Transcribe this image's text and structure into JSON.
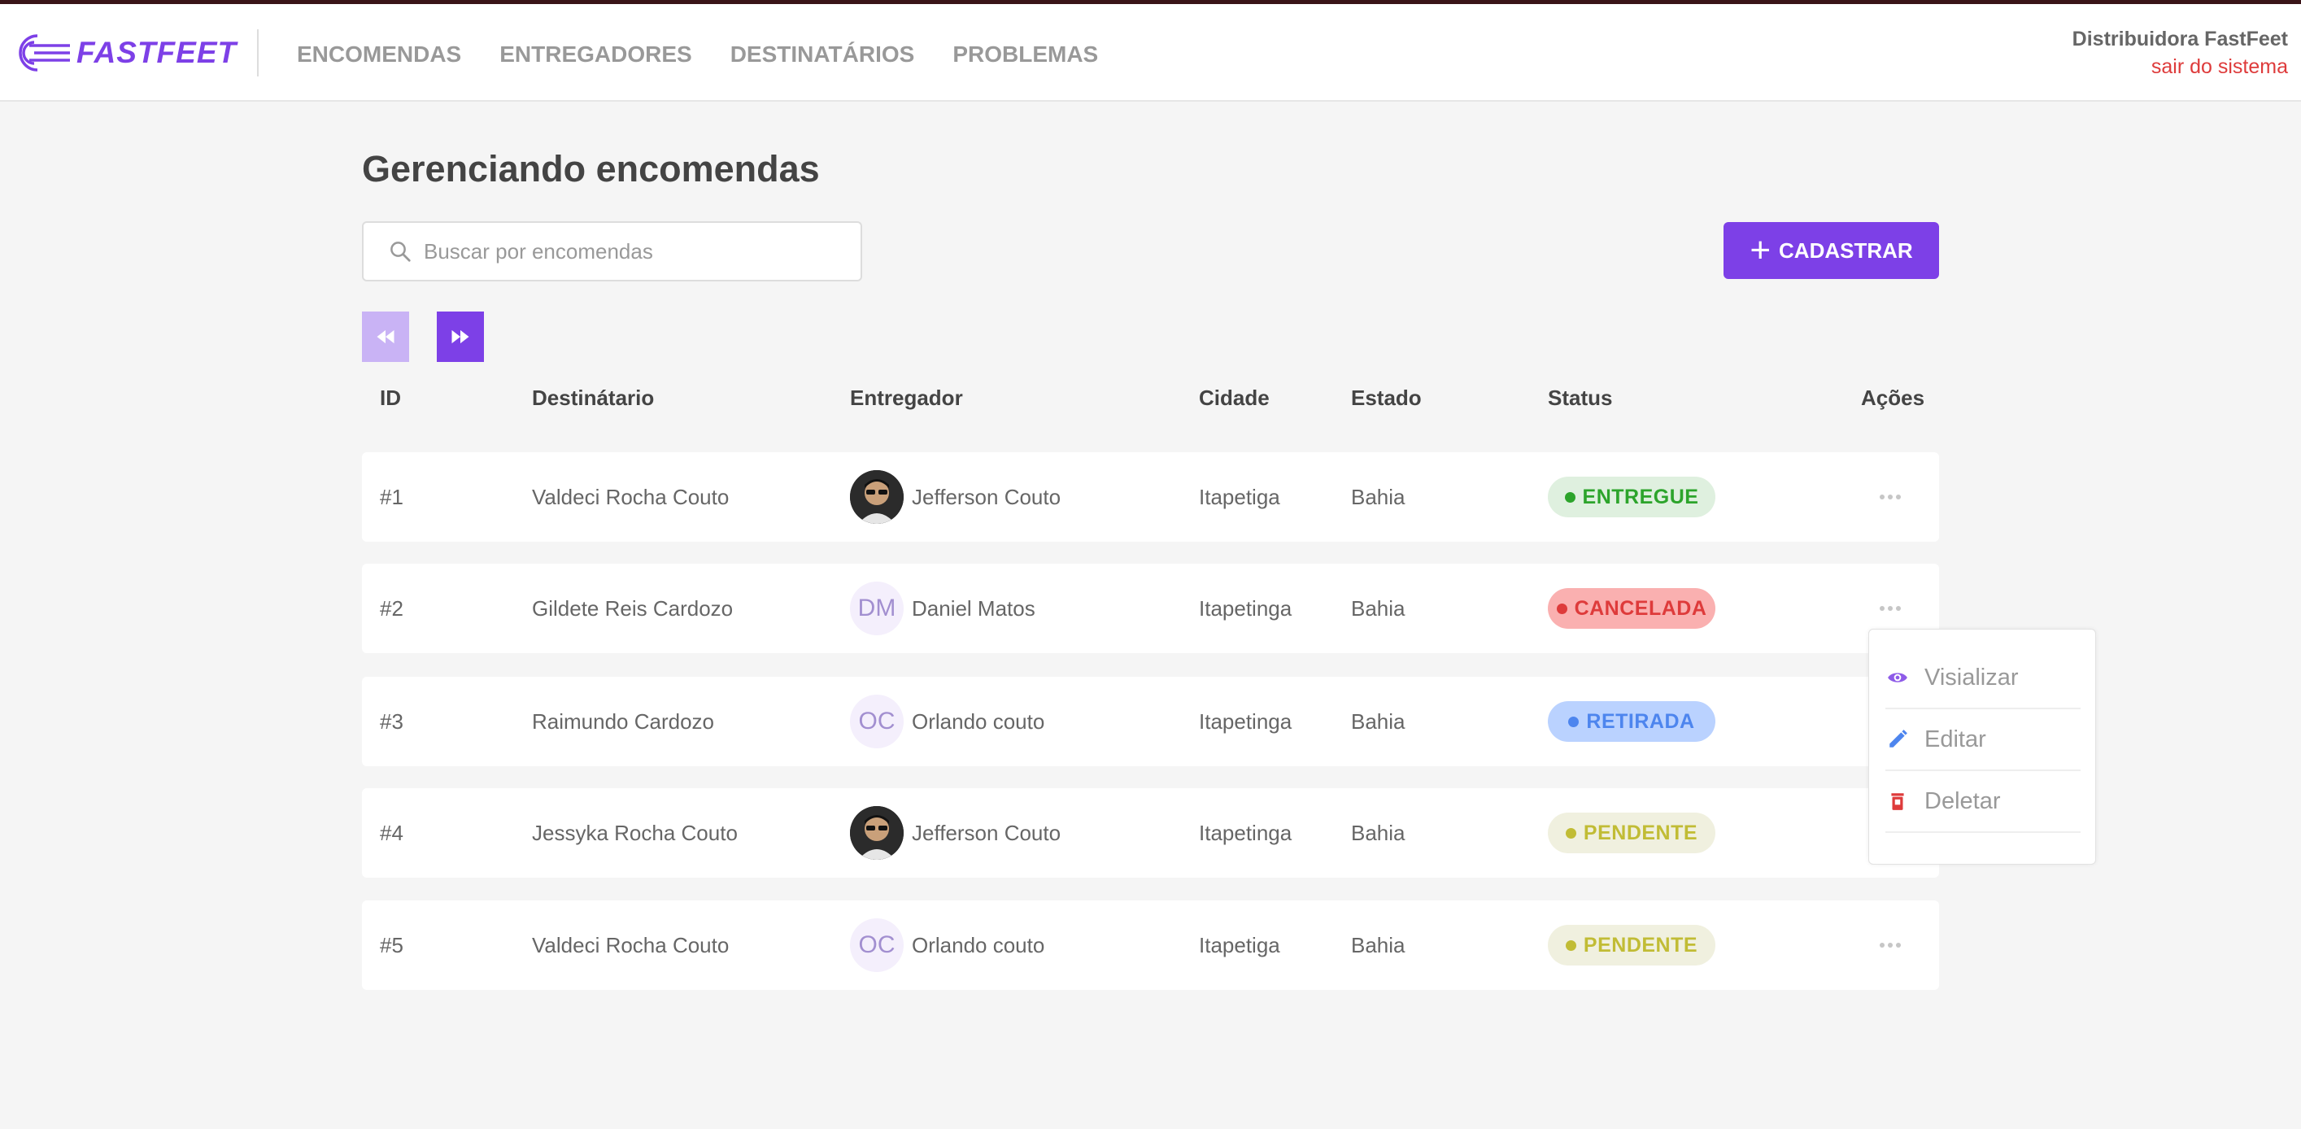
{
  "app": {
    "logo_text": "FASTFEET",
    "brand_color": "#7d40e7"
  },
  "nav": {
    "items": [
      "ENCOMENDAS",
      "ENTREGADORES",
      "DESTINATÁRIOS",
      "PROBLEMAS"
    ]
  },
  "user": {
    "name": "Distribuidora FastFeet",
    "logout": "sair do sistema"
  },
  "page": {
    "title": "Gerenciando encomendas",
    "search_placeholder": "Buscar por encomendas",
    "add_button": "CADASTRAR"
  },
  "table": {
    "headers": {
      "id": "ID",
      "recipient": "Destinátario",
      "deliveryman": "Entregador",
      "city": "Cidade",
      "state": "Estado",
      "status": "Status",
      "actions": "Ações"
    },
    "rows": [
      {
        "id": "#1",
        "recipient": "Valdeci Rocha Couto",
        "deliveryman": "Jefferson Couto",
        "avatar_initials": "",
        "city": "Itapetiga",
        "state": "Bahia",
        "status": "ENTREGUE",
        "status_fg": "#2ca42b",
        "status_bg": "#dff0df"
      },
      {
        "id": "#2",
        "recipient": "Gildete Reis Cardozo",
        "deliveryman": "Daniel Matos",
        "avatar_initials": "DM",
        "city": "Itapetinga",
        "state": "Bahia",
        "status": "CANCELADA",
        "status_fg": "#de3b3b",
        "status_bg": "#fab0b0"
      },
      {
        "id": "#3",
        "recipient": "Raimundo Cardozo",
        "deliveryman": "Orlando couto",
        "avatar_initials": "OC",
        "city": "Itapetinga",
        "state": "Bahia",
        "status": "RETIRADA",
        "status_fg": "#4d85ee",
        "status_bg": "#bad2ff"
      },
      {
        "id": "#4",
        "recipient": "Jessyka Rocha Couto",
        "deliveryman": "Jefferson Couto",
        "avatar_initials": "",
        "city": "Itapetinga",
        "state": "Bahia",
        "status": "PENDENTE",
        "status_fg": "#c1bc35",
        "status_bg": "#f0f0df"
      },
      {
        "id": "#5",
        "recipient": "Valdeci Rocha Couto",
        "deliveryman": "Orlando couto",
        "avatar_initials": "OC",
        "city": "Itapetiga",
        "state": "Bahia",
        "status": "PENDENTE",
        "status_fg": "#c1bc35",
        "status_bg": "#f0f0df"
      }
    ]
  },
  "action_menu": {
    "items": [
      {
        "label": "Visializar",
        "icon": "eye-icon",
        "color": "#8e5be8"
      },
      {
        "label": "Editar",
        "icon": "pencil-icon",
        "color": "#4d85ee"
      },
      {
        "label": "Deletar",
        "icon": "trash-icon",
        "color": "#de3b3b"
      }
    ]
  }
}
